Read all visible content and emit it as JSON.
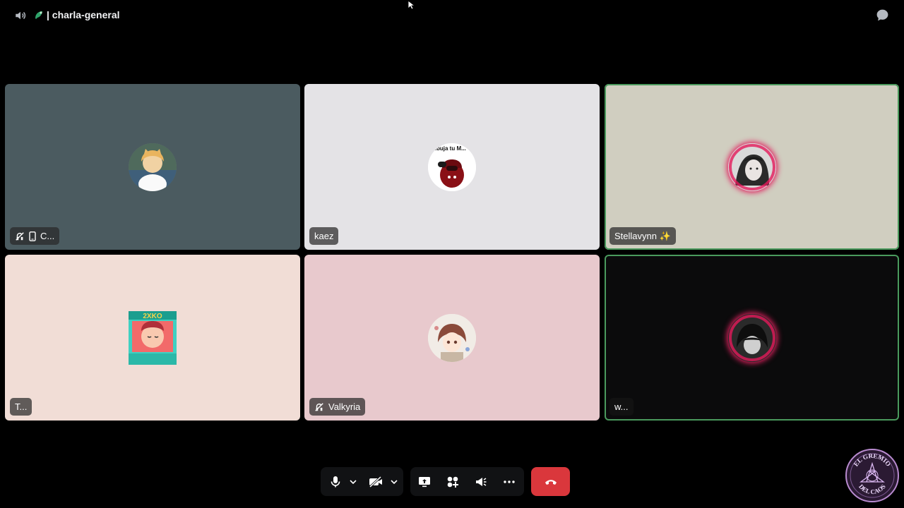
{
  "header": {
    "channel_name": "| charla-general"
  },
  "tiles": [
    {
      "name": "C...",
      "bg": "#4b5b60",
      "muted_deafened": true,
      "mobile": true,
      "speaking": false
    },
    {
      "name": "kaez",
      "bg": "#e4e3e6",
      "speaking": false
    },
    {
      "name": "Stellavynn ✨",
      "bg": "#d0cec0",
      "speaking": true
    },
    {
      "name": "T...",
      "bg": "#f1ddd6",
      "speaking": false
    },
    {
      "name": "Valkyria",
      "bg": "#e8c9cd",
      "muted_deafened": true,
      "speaking": false
    },
    {
      "name": "w...",
      "bg": "#0b0b0c",
      "speaking": true
    }
  ],
  "avatar_text": {
    "kaez_sticker": "Dibuja tu M..."
  },
  "logo": {
    "line1": "EL GREMIO",
    "line2": "DEL CAOS"
  },
  "colors": {
    "accent_speaking": "#4a9a5d",
    "hangup": "#da373c",
    "control_bg": "#111214"
  },
  "icons": [
    "speaker-icon",
    "channel-icon",
    "chat-bubble-icon",
    "microphone-icon",
    "camera-off-icon",
    "screen-share-icon",
    "activities-icon",
    "soundboard-icon",
    "more-icon",
    "hangup-icon"
  ]
}
